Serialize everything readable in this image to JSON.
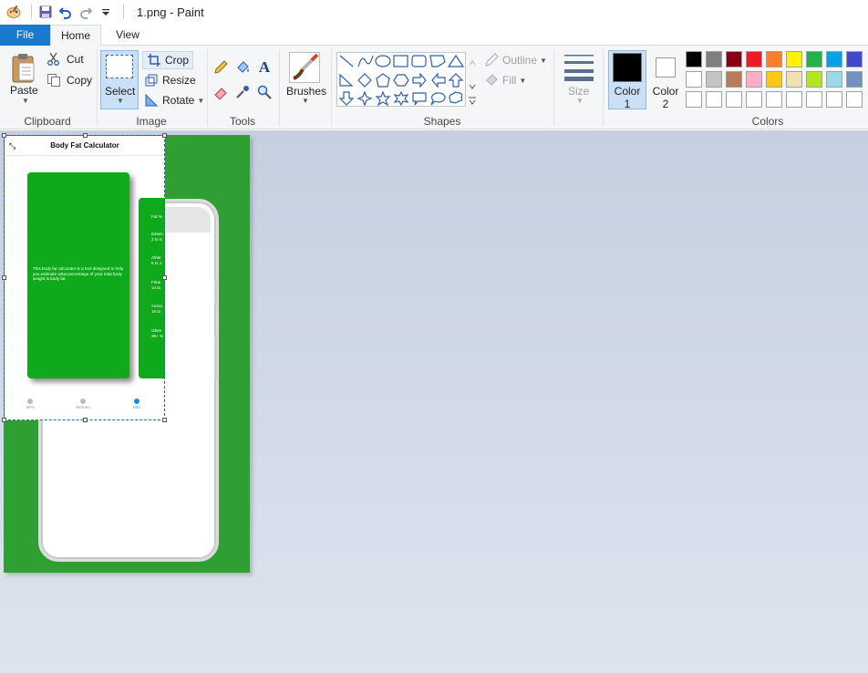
{
  "window": {
    "title": "1.png - Paint"
  },
  "quick_access": {
    "app_icon": "paint-palette-icon",
    "save_icon": "save-icon",
    "undo_icon": "undo-icon",
    "redo_icon": "redo-icon",
    "customize_icon": "customize-quick-access-icon"
  },
  "tabs": {
    "file": "File",
    "home": "Home",
    "view": "View"
  },
  "clipboard": {
    "paste": "Paste",
    "cut": "Cut",
    "copy": "Copy",
    "label": "Clipboard"
  },
  "image": {
    "select": "Select",
    "crop": "Crop",
    "resize": "Resize",
    "rotate": "Rotate",
    "label": "Image"
  },
  "tools": {
    "label": "Tools",
    "items": [
      "pencil-icon",
      "fill-icon",
      "text-icon",
      "eraser-icon",
      "color-picker-icon",
      "magnifier-icon"
    ]
  },
  "brushes": {
    "label": "Brushes"
  },
  "shapes": {
    "label": "Shapes",
    "outline": "Outline",
    "fill": "Fill",
    "items": [
      "line",
      "curve",
      "oval",
      "rectangle",
      "rounded-rectangle",
      "polygon",
      "triangle",
      "right-triangle",
      "diamond",
      "pentagon",
      "hexagon",
      "right-arrow",
      "left-arrow",
      "up-arrow",
      "down-arrow",
      "four-point-star",
      "five-point-star",
      "six-point-star",
      "rounded-callout",
      "oval-callout",
      "cloud-callout"
    ]
  },
  "size": {
    "label": "Size"
  },
  "colors": {
    "label": "Colors",
    "color1_label": "Color 1",
    "color2_label": "Color 2",
    "color1": "#000000",
    "color2": "#ffffff",
    "palette_row1": [
      "#000000",
      "#7f7f7f",
      "#880015",
      "#ed1c24",
      "#ff7f27",
      "#fff200",
      "#22b14c",
      "#00a2e8",
      "#3f48cc"
    ],
    "palette_row2": [
      "#ffffff",
      "#c3c3c3",
      "#b97a57",
      "#ffaec9",
      "#ffc90e",
      "#efe4b0",
      "#b5e61d",
      "#99d9ea",
      "#7092be"
    ],
    "palette_row3": [
      "#ffffff",
      "#ffffff",
      "#ffffff",
      "#ffffff",
      "#ffffff",
      "#ffffff",
      "#ffffff",
      "#ffffff",
      "#ffffff"
    ]
  },
  "canvas": {
    "pasted_app": {
      "title": "Body Fat Calculator",
      "card_text": "This body fat calculator is a tool designed to help you estimate what percentage of your total body weight is body fat.",
      "side_lines": [
        "Fat %",
        "Essen",
        "2 to 5",
        "Athle",
        "6 to 1",
        "Fitne",
        "14 to",
        "Avera",
        "18 to",
        "Obes",
        "25+ %"
      ],
      "nav": [
        "Men",
        "Women",
        "Info"
      ]
    }
  }
}
